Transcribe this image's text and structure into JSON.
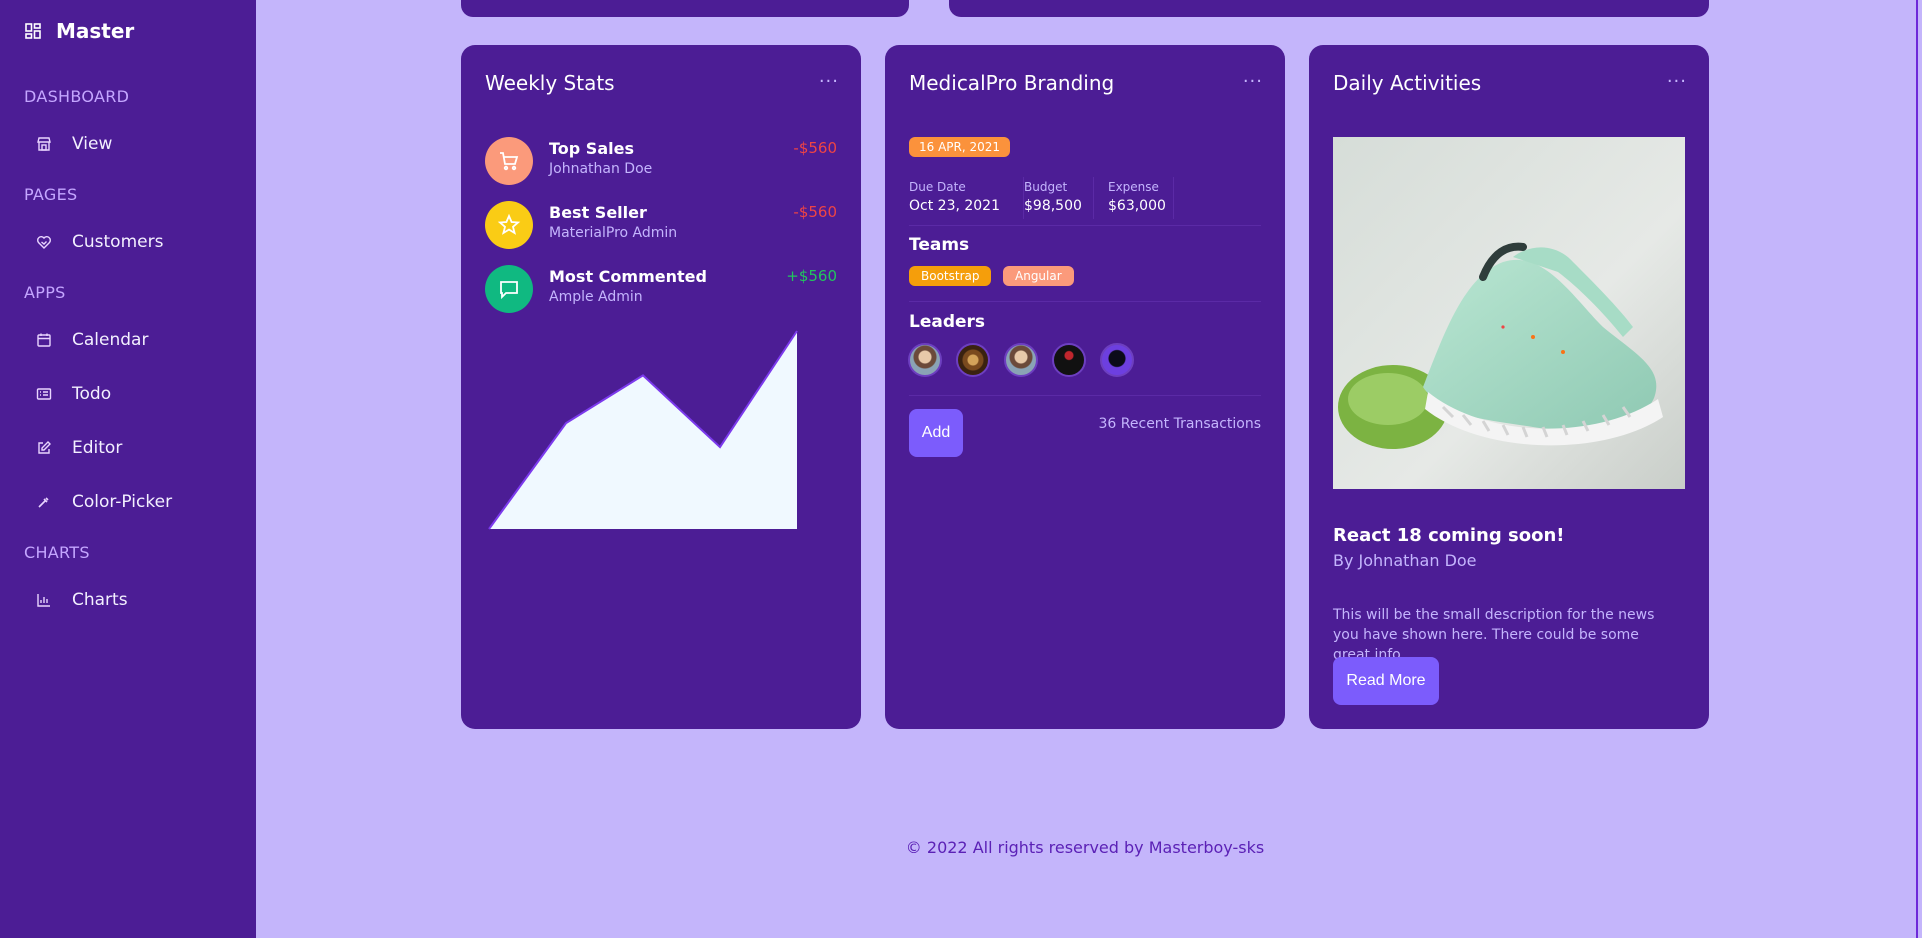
{
  "sidebar": {
    "brand": "Master",
    "sections": [
      {
        "label": "DASHBOARD",
        "items": [
          {
            "label": "View",
            "icon": "store-icon"
          }
        ]
      },
      {
        "label": "PAGES",
        "items": [
          {
            "label": "Customers",
            "icon": "heart-handshake-icon"
          }
        ]
      },
      {
        "label": "APPS",
        "items": [
          {
            "label": "Calendar",
            "icon": "calendar-icon"
          },
          {
            "label": "Todo",
            "icon": "list-icon"
          },
          {
            "label": "Editor",
            "icon": "edit-icon"
          },
          {
            "label": "Color-Picker",
            "icon": "eyedropper-icon"
          }
        ]
      },
      {
        "label": "CHARTS",
        "items": [
          {
            "label": "Charts",
            "icon": "bar-chart-icon"
          }
        ]
      }
    ]
  },
  "weekly": {
    "title": "Weekly Stats",
    "more": "···",
    "rows": [
      {
        "title": "Top Sales",
        "sub": "Johnathan Doe",
        "amount": "-$560",
        "icon": "cart-icon",
        "color": "#fb9a7b",
        "amount_color": "#ef4444"
      },
      {
        "title": "Best Seller",
        "sub": "MaterialPro Admin",
        "amount": "-$560",
        "icon": "star-icon",
        "color": "#facc15",
        "amount_color": "#ef4444"
      },
      {
        "title": "Most Commented",
        "sub": "Ample Admin",
        "amount": "+$560",
        "icon": "message-icon",
        "color": "#10b981",
        "amount_color": "#22c55e"
      }
    ]
  },
  "chart_data": {
    "type": "area",
    "x": [
      0,
      1,
      2,
      3,
      4
    ],
    "y": [
      0,
      31,
      45,
      24,
      58
    ],
    "ylim": [
      0,
      58
    ],
    "fill": "#f0f9ff",
    "stroke": "#7c3aed",
    "grid": false
  },
  "branding": {
    "title": "MedicalPro Branding",
    "more": "···",
    "date": "16 APR, 2021",
    "meta": [
      {
        "label": "Due Date",
        "value": "Oct 23, 2021"
      },
      {
        "label": "Budget",
        "value": "$98,500"
      },
      {
        "label": "Expense",
        "value": "$63,000"
      }
    ],
    "teams_title": "Teams",
    "teams": [
      {
        "label": "Bootstrap",
        "color": "#f59e0b"
      },
      {
        "label": "Angular",
        "color": "#fb9a7b"
      }
    ],
    "leaders_title": "Leaders",
    "add": "Add",
    "recent": "36 Recent Transactions"
  },
  "daily": {
    "title": "Daily Activities",
    "more": "···",
    "news_title": "React 18 coming soon!",
    "news_by": "By Johnathan Doe",
    "news_desc": "This will be the small description for the news you have shown here. There could be some great info.",
    "read_more": "Read More"
  },
  "footer": "© 2022 All rights reserved by Masterboy-sks"
}
